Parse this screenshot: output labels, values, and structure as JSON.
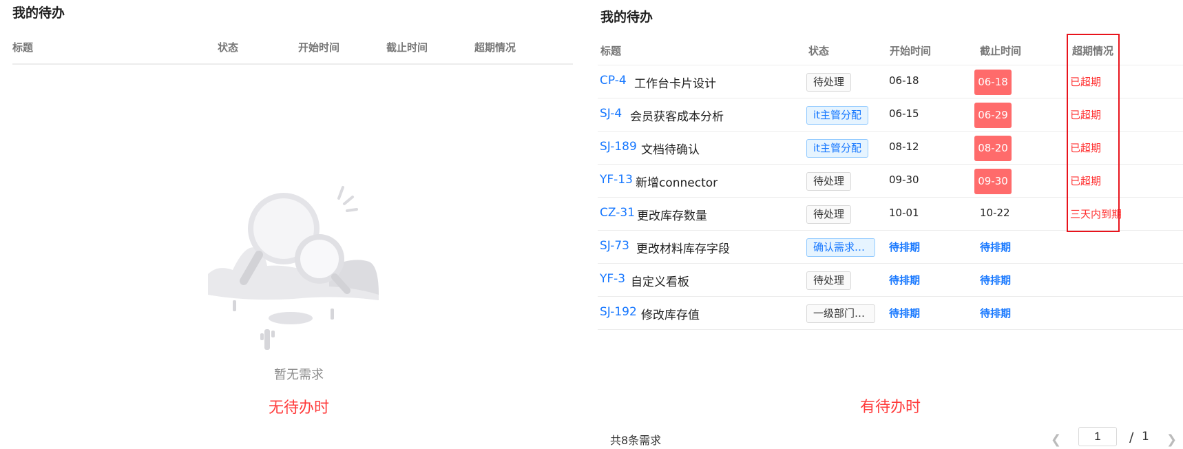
{
  "empty_panel": {
    "title": "我的待办",
    "columns": [
      "标题",
      "状态",
      "开始时间",
      "截止时间",
      "超期情况"
    ],
    "empty_text": "暂无需求",
    "annotation": "无待办时"
  },
  "list_panel": {
    "title": "我的待办",
    "columns": [
      "标题",
      "状态",
      "开始时间",
      "截止时间",
      "超期情况"
    ],
    "rows": [
      {
        "code": "CP-4",
        "title": "工作台卡片设计",
        "status": "待处理",
        "start": "06-18",
        "end": "06-18",
        "overdue": "已超期"
      },
      {
        "code": "SJ-4",
        "title": "会员获客成本分析",
        "status": "it主管分配",
        "start": "06-15",
        "end": "06-29",
        "overdue": "已超期"
      },
      {
        "code": "SJ-189",
        "title": "文档待确认",
        "status": "it主管分配",
        "start": "08-12",
        "end": "08-20",
        "overdue": "已超期"
      },
      {
        "code": "YF-13",
        "title": "新增connector",
        "status": "待处理",
        "start": "09-30",
        "end": "09-30",
        "overdue": "已超期"
      },
      {
        "code": "CZ-31",
        "title": "更改库存数量",
        "status": "待处理",
        "start": "10-01",
        "end": "10-22",
        "overdue": "三天内到期"
      },
      {
        "code": "SJ-73",
        "title": "更改材料库存字段",
        "status": "确认需求…",
        "start": "待排期",
        "end": "待排期",
        "overdue": ""
      },
      {
        "code": "YF-3",
        "title": "自定义看板",
        "status": "待处理",
        "start": "待排期",
        "end": "待排期",
        "overdue": ""
      },
      {
        "code": "SJ-192",
        "title": "修改库存值",
        "status": "一级部门…",
        "start": "待排期",
        "end": "待排期",
        "overdue": ""
      }
    ],
    "annotation": "有待办时",
    "footer_count": "共8条需求",
    "pager": {
      "current": "1",
      "separator": "/",
      "total": "1"
    }
  },
  "colors": {
    "link_blue": "#1677ff",
    "overdue_red": "#ff3030",
    "overdue_box": "#ff6b6b",
    "annotation_red": "#ff3b3b",
    "frame_red": "#e8131c"
  },
  "icons": {
    "prev": "chevron-left-icon",
    "next": "chevron-right-icon",
    "empty": "empty-search-illustration"
  }
}
